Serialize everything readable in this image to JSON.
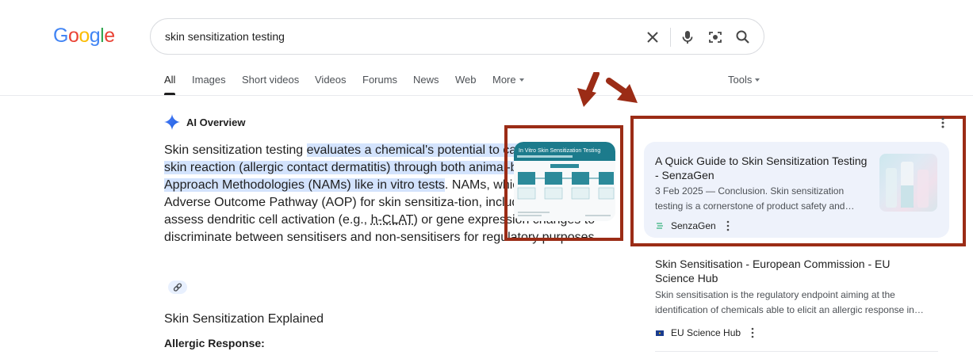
{
  "logo": {
    "letters": [
      "G",
      "o",
      "o",
      "g",
      "l",
      "e"
    ],
    "colors": [
      "#4285f4",
      "#ea4335",
      "#fbbc05",
      "#4285f4",
      "#34a853",
      "#ea4335"
    ]
  },
  "search": {
    "query": "skin sensitization testing"
  },
  "tabs": [
    {
      "label": "All",
      "active": true
    },
    {
      "label": "Images"
    },
    {
      "label": "Short videos"
    },
    {
      "label": "Videos"
    },
    {
      "label": "Forums"
    },
    {
      "label": "News"
    },
    {
      "label": "Web"
    },
    {
      "label": "More"
    }
  ],
  "tools_label": "Tools",
  "ai_overview": {
    "title": "AI Overview",
    "p1_plain_start": "Skin sensitization testing ",
    "p1_highlight": "evaluates a chemical's potential to cause an allergic skin reaction (allergic contact dermatitis) through both animal-based and New Approach Methodologies (NAMs) like in vitro tests",
    "p1_plain_mid": ". NAMs, which fol-low an Adverse Outcome Pathway (AOP) for skin sensitiza-tion, include methods that assess dendritic cell activation (e.g., ",
    "p1_abbr": "h-CLAT",
    "p1_plain_end": ") or gene expression changes to discriminate between sensitisers and non-sensitisers for regulatory purposes.",
    "subheading": "Skin Sensitization Explained",
    "subheading2": "Allergic Response:",
    "thumbnail_title": "In Vitro Skin Sensitization Testing"
  },
  "sources": [
    {
      "title": "A Quick Guide to Skin Sensitization Testing - SenzaGen",
      "snippet": "3 Feb 2025 — Conclusion. Skin sensitization testing is a cornerstone of product safety and…",
      "site": "SenzaGen"
    },
    {
      "title": "Skin Sensitisation - European Commission - EU Science Hub",
      "snippet": "Skin sensitisation is the regulatory endpoint aiming at the identification of chemicals able to elicit an allergic response in…",
      "site": "EU Science Hub"
    }
  ],
  "colors": {
    "annotation_red": "#9b2c16",
    "highlight": "#d3e3fd",
    "card_bg": "#eef2fb"
  }
}
